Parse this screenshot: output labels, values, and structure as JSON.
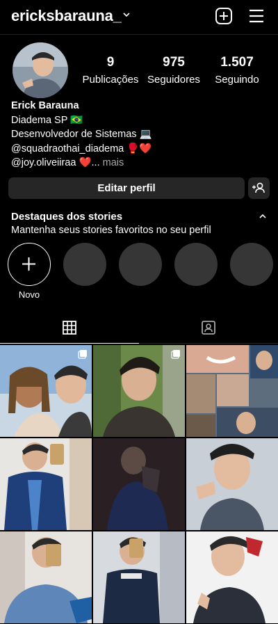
{
  "header": {
    "username": "ericksbarauna_"
  },
  "stats": [
    {
      "value": "9",
      "label": "Publicações"
    },
    {
      "value": "975",
      "label": "Seguidores"
    },
    {
      "value": "1.507",
      "label": "Seguindo"
    }
  ],
  "bio": {
    "name": "Erick Barauna",
    "lines": [
      "Diadema SP 🇧🇷",
      "Desenvolvedor de Sistemas 💻",
      "@squadraothai_diadema 🥊❤️",
      "@joy.oliveiiraa ❤️..."
    ],
    "more": " mais"
  },
  "actions": {
    "edit_profile": "Editar perfil"
  },
  "highlights": {
    "title": "Destaques dos stories",
    "subtitle": "Mantenha seus stories favoritos no seu perfil",
    "new_label": "Novo"
  },
  "tabs": [
    {
      "icon": "grid-icon",
      "active": true
    },
    {
      "icon": "tagged-icon",
      "active": false
    }
  ],
  "colors": {
    "background": "#000000",
    "button": "#262626",
    "placeholder": "#363636",
    "muted": "#a8a8a8"
  },
  "posts": [
    {
      "name": "post-1",
      "multiple": true
    },
    {
      "name": "post-2",
      "multiple": true
    },
    {
      "name": "post-3",
      "multiple": false
    },
    {
      "name": "post-4",
      "multiple": false
    },
    {
      "name": "post-5",
      "multiple": false
    },
    {
      "name": "post-6",
      "multiple": false
    },
    {
      "name": "post-7",
      "multiple": false
    },
    {
      "name": "post-8",
      "multiple": false
    },
    {
      "name": "post-9",
      "multiple": false
    }
  ]
}
